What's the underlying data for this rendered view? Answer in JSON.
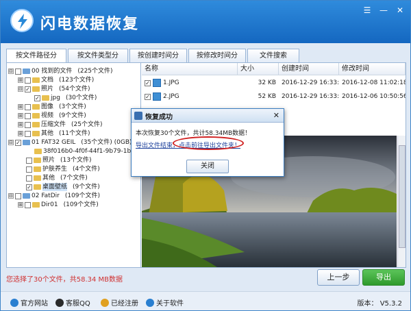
{
  "app": {
    "title": "闪电数据恢复"
  },
  "window_buttons": [
    "☰",
    "—",
    "✕"
  ],
  "tabs": [
    {
      "label": "按文件路径分类"
    },
    {
      "label": "按文件类型分类"
    },
    {
      "label": "按创建时间分类"
    },
    {
      "label": "按修改时间分类"
    },
    {
      "label": "文件搜索"
    }
  ],
  "tree": [
    {
      "exp": "⊟",
      "icon": "folder",
      "label": "00 找到的文件",
      "count": "(225个文件)"
    },
    {
      "exp": "⊞",
      "icon": "folder",
      "label": "文档",
      "count": "(123个文件)"
    },
    {
      "exp": "⊟",
      "icon": "folder",
      "label": "照片",
      "count": "(54个文件)"
    },
    {
      "exp": "",
      "icon": "folder",
      "label": "jpg",
      "count": "(30个文件)"
    },
    {
      "exp": "⊞",
      "icon": "folder",
      "label": "图像",
      "count": "(3个文件)"
    },
    {
      "exp": "⊞",
      "icon": "folder",
      "label": "视频",
      "count": "(9个文件)"
    },
    {
      "exp": "⊞",
      "icon": "folder",
      "label": "压缩文件",
      "count": "(25个文件)"
    },
    {
      "exp": "⊞",
      "icon": "folder",
      "label": "其他",
      "count": "(11个文件)"
    },
    {
      "exp": "⊟",
      "icon": "drive",
      "label": "01 FAT32 GEIL",
      "count": "(35个文件) (0GB)"
    },
    {
      "exp": "",
      "icon": "folder",
      "label": "38f016b0-4f0f-44f1-9b79-1b1a24",
      "count": ""
    },
    {
      "exp": "",
      "icon": "folder",
      "label": "照片",
      "count": "(13个文件)"
    },
    {
      "exp": "",
      "icon": "folder",
      "label": "护肤养生",
      "count": "(4个文件)"
    },
    {
      "exp": "",
      "icon": "folder",
      "label": "其他",
      "count": "(7个文件)"
    },
    {
      "exp": "",
      "icon": "folder",
      "label": "桌面壁纸",
      "count": "(9个文件)"
    },
    {
      "exp": "⊟",
      "icon": "drive",
      "label": "02 FatDir",
      "count": "(109个文件)"
    },
    {
      "exp": "⊞",
      "icon": "folder",
      "label": "Dir01",
      "count": "(109个文件)"
    }
  ],
  "filelist": {
    "headers": [
      "名称",
      "大小",
      "创建时间",
      "修改时间"
    ],
    "rows": [
      {
        "name": "1.JPG",
        "size": "32 KB",
        "created": "2016-12-29  16:33:30",
        "modified": "2016-12-08  11:02:18"
      },
      {
        "name": "2.JPG",
        "size": "52 KB",
        "created": "2016-12-29  16:33:30",
        "modified": "2016-12-06  10:50:56"
      }
    ]
  },
  "status": {
    "text": "您选择了30个文件，共58.34 MB数据"
  },
  "buttons": {
    "prev": "上一步",
    "export": "导出"
  },
  "footer": {
    "links": [
      "官方网站",
      "客服QQ",
      "已经注册",
      "关于软件"
    ],
    "version": "版本： V5.3.2"
  },
  "dialog": {
    "title": "恢复成功",
    "close": "✕",
    "message1": "本次恢复30个文件，共计58.34MB数据！",
    "message2_prefix": "导出文件结束，",
    "message2_link": "点击前往导出文件夹！",
    "ok": "关闭"
  }
}
